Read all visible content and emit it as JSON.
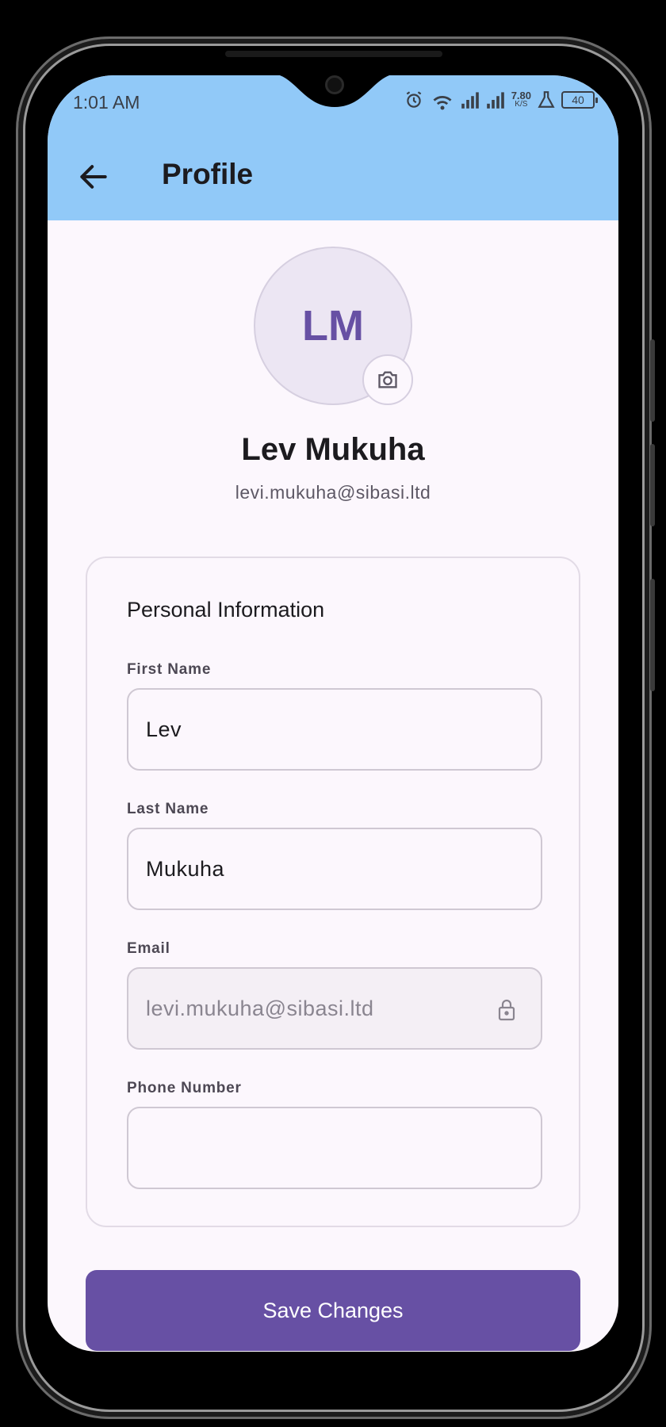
{
  "status_bar": {
    "time": "1:01 AM",
    "speed_value": "7.80",
    "speed_unit": "K/S",
    "battery": "40"
  },
  "header": {
    "title": "Profile",
    "back_icon": "arrow-left-icon"
  },
  "profile": {
    "initials": "LM",
    "camera_icon": "camera-icon",
    "full_name": "Lev Mukuha",
    "email": "levi.mukuha@sibasi.ltd"
  },
  "personal_info": {
    "section_title": "Personal Information",
    "first_name": {
      "label": "First Name",
      "value": "Lev"
    },
    "last_name": {
      "label": "Last Name",
      "value": "Mukuha"
    },
    "email": {
      "label": "Email",
      "value": "levi.mukuha@sibasi.ltd",
      "icon": "lock-icon"
    },
    "phone": {
      "label": "Phone Number",
      "value": ""
    }
  },
  "actions": {
    "save_label": "Save Changes"
  },
  "colors": {
    "appbar": "#91c9f8",
    "primary": "#6750a4",
    "background": "#fcf7fd"
  }
}
